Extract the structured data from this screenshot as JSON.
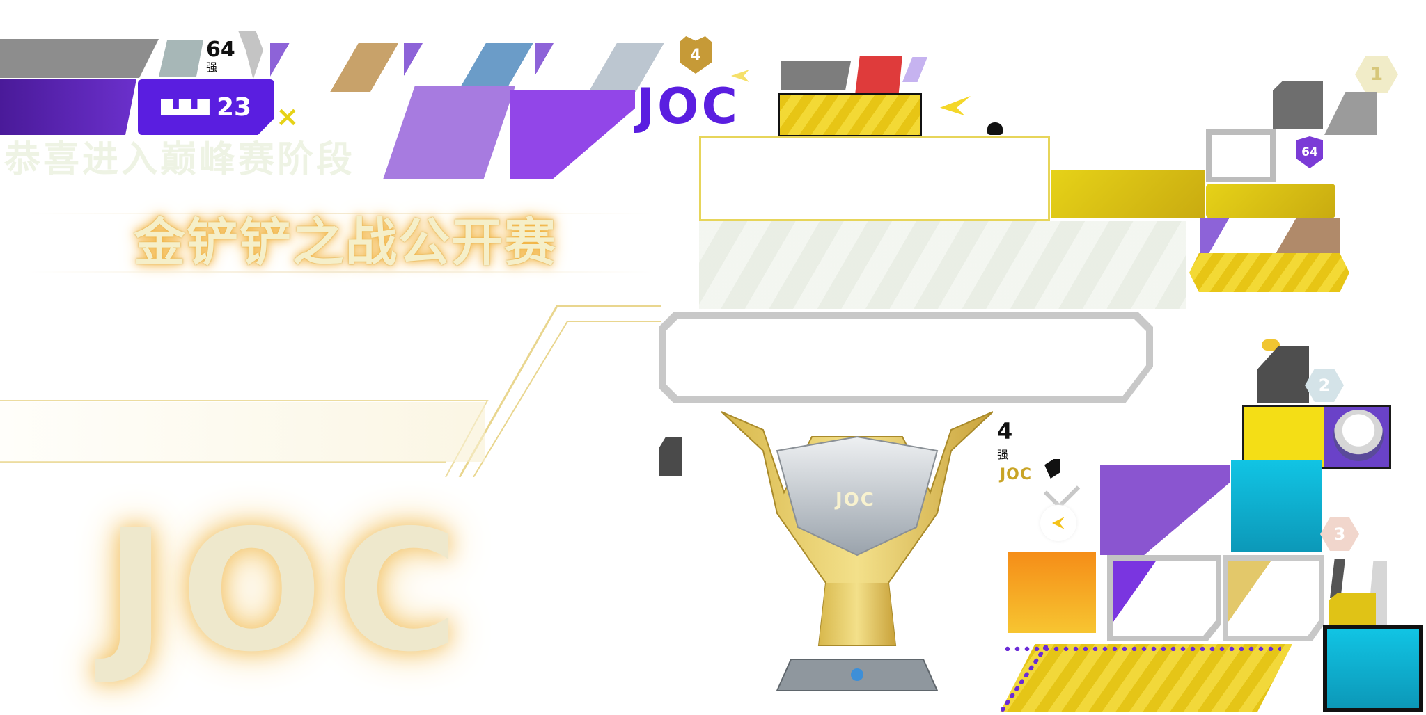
{
  "top_badges": {
    "rank_64_number": "64",
    "rank_64_unit": "强",
    "season_number": "23",
    "close_symbol": "×",
    "medal_4_number": "4"
  },
  "logo_text": "JOC",
  "banner": {
    "congrats": "恭喜进入巅峰赛阶段",
    "title": "金铲铲之战公开赛"
  },
  "right_panel": {
    "rank_1": "1",
    "rank_64_shield": "64",
    "rank_2": "2",
    "rank_3": "3",
    "rank_4_number": "4",
    "rank_4_unit": "强"
  },
  "colors": {
    "purple": "#6a2bd6",
    "lavender": "#a77be0",
    "gold": "#e6d218",
    "cyan": "#11c4e4",
    "orange": "#f58d18",
    "gray": "#8d8d8d"
  }
}
